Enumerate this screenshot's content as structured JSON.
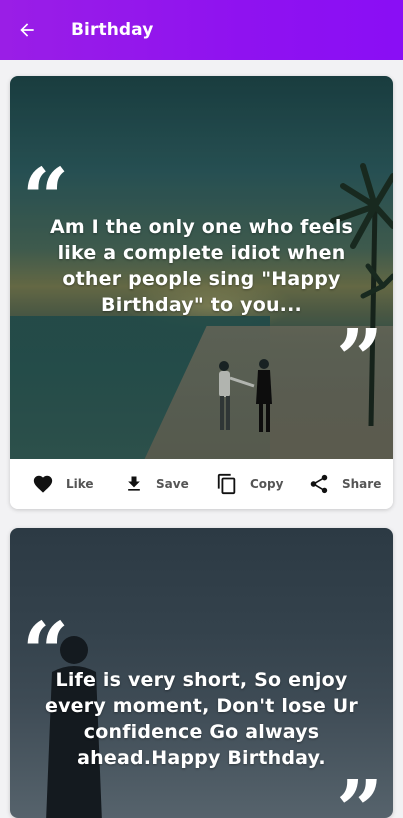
{
  "appbar": {
    "title": "Birthday"
  },
  "cards": [
    {
      "quote": "Am I the only one who feels like a complete idiot when other people sing \"Happy Birthday\" to you...",
      "actions": {
        "like": "Like",
        "save": "Save",
        "copy": "Copy",
        "share": "Share"
      }
    },
    {
      "quote": "Life is very short, So enjoy every moment, Don't lose Ur confidence Go always ahead.Happy Birthday."
    }
  ],
  "colors": {
    "appbar": "#9a1ee6",
    "action_text": "#555555"
  },
  "icons": {
    "back": "arrow-left",
    "like": "heart",
    "save": "download",
    "copy": "copy",
    "share": "share"
  }
}
